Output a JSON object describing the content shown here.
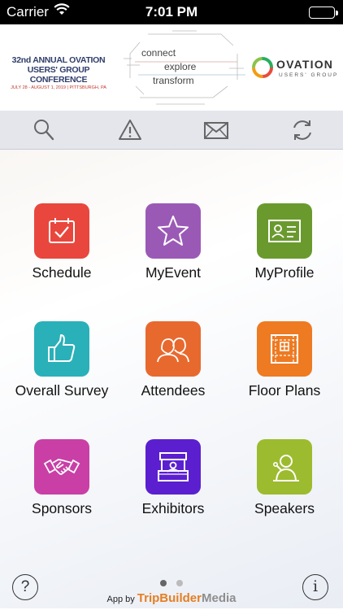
{
  "status_bar": {
    "carrier": "Carrier",
    "time": "7:01 PM"
  },
  "banner": {
    "conference_line1": "32nd ANNUAL OVATION",
    "conference_line2": "USERS' GROUP CONFERENCE",
    "conference_dates": "JULY 28 - AUGUST 1, 2019 | PITTSBURGH, PA",
    "tagline_words": [
      "connect",
      "explore",
      "transform"
    ],
    "brand_name": "OVATION",
    "brand_sub": "USERS' GROUP"
  },
  "toolbar": {
    "icons": [
      "search-icon",
      "alert-icon",
      "mail-icon",
      "sync-icon"
    ]
  },
  "tiles": [
    {
      "label": "Schedule",
      "icon": "calendar-icon",
      "color": "#e9473d"
    },
    {
      "label": "MyEvent",
      "icon": "star-icon",
      "color": "#9b59b6"
    },
    {
      "label": "MyProfile",
      "icon": "id-card-icon",
      "color": "#6a9a2e"
    },
    {
      "label": "Overall Survey",
      "icon": "thumbs-up-icon",
      "color": "#2ab0b8"
    },
    {
      "label": "Attendees",
      "icon": "people-icon",
      "color": "#e8692e"
    },
    {
      "label": "Floor Plans",
      "icon": "floor-plan-icon",
      "color": "#ee7a22"
    },
    {
      "label": "Sponsors",
      "icon": "handshake-icon",
      "color": "#c93fa6"
    },
    {
      "label": "Exhibitors",
      "icon": "booth-icon",
      "color": "#5b1fd0"
    },
    {
      "label": "Speakers",
      "icon": "speaker-icon",
      "color": "#9dbb2e"
    }
  ],
  "pager": {
    "pages": 2,
    "current": 1
  },
  "footer": {
    "prefix": "App by",
    "brand_part1": "TripBuilder",
    "brand_part2": "Media",
    "help_glyph": "?",
    "info_glyph": "i"
  }
}
